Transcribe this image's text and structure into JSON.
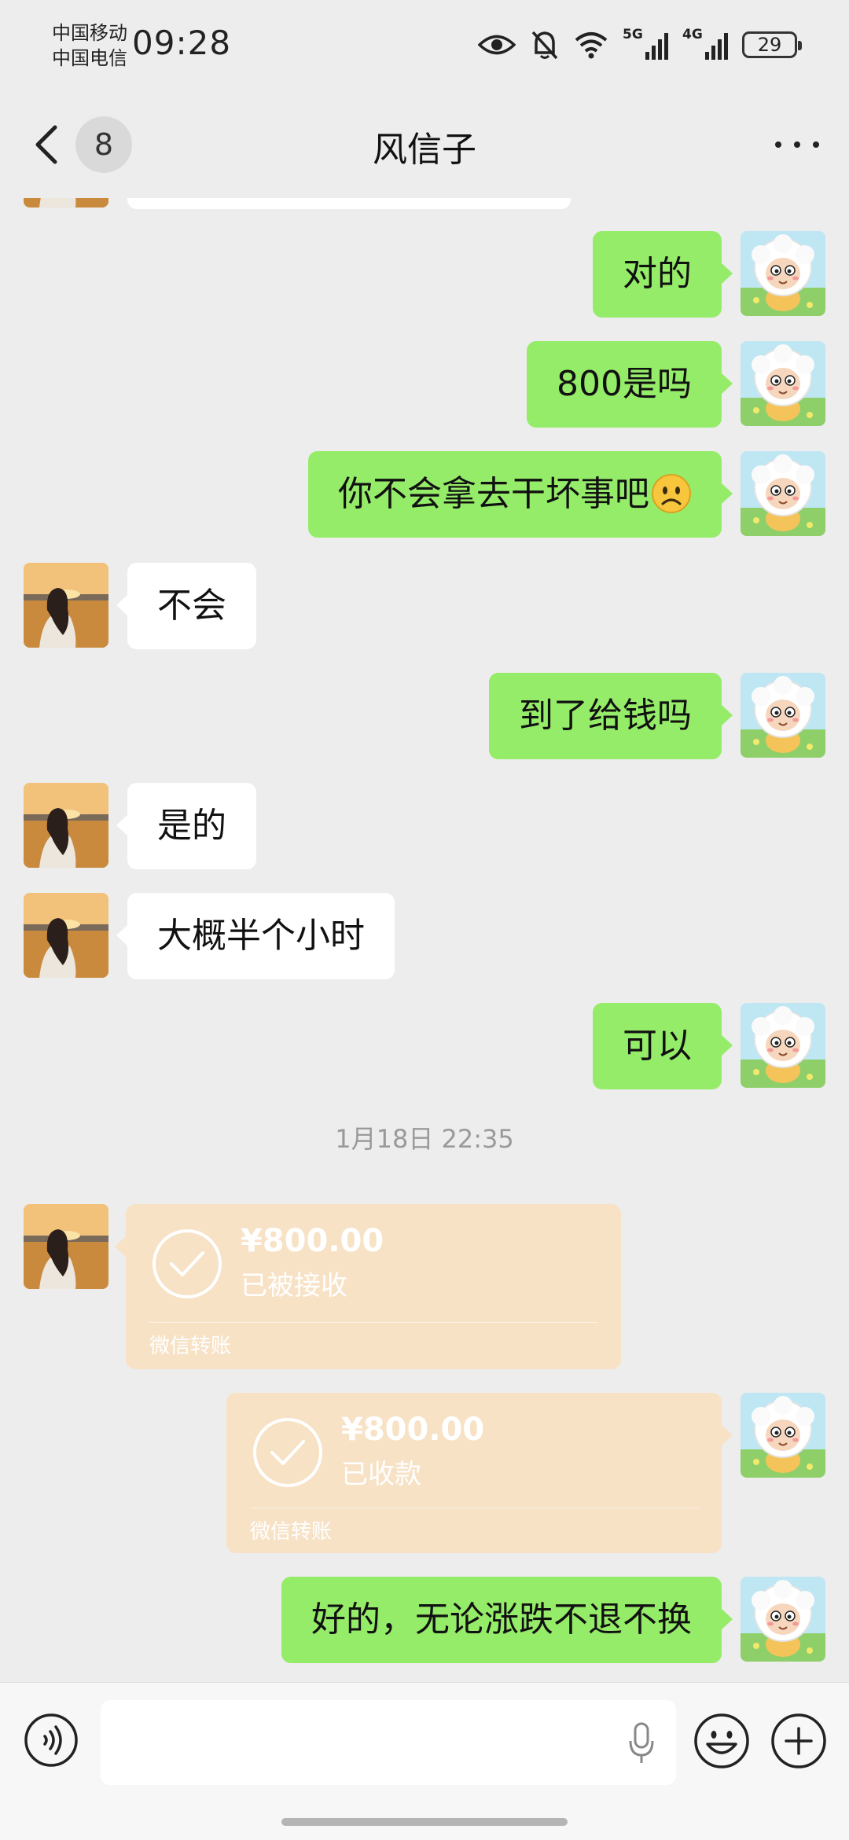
{
  "status_bar": {
    "carrier_1": "中国移动",
    "carrier_2": "中国电信",
    "time": "09:28",
    "net_1": "5G",
    "net_2": "4G",
    "battery": "29",
    "icons": [
      "eye-icon",
      "mute-bell-icon",
      "wifi-icon",
      "signal-icon",
      "battery-icon"
    ]
  },
  "nav": {
    "unread_count": "8",
    "title": "风信子",
    "back_icon": "chevron-left-icon",
    "more_icon": "ellipsis-icon"
  },
  "messages": [
    {
      "side": "out",
      "text": "对的"
    },
    {
      "side": "out",
      "text": "800是吗"
    },
    {
      "side": "out",
      "text": "你不会拿去干坏事吧",
      "emoji": "sad-face"
    },
    {
      "side": "in",
      "text": "不会"
    },
    {
      "side": "out",
      "text": "到了给钱吗"
    },
    {
      "side": "in",
      "text": "是的"
    },
    {
      "side": "in",
      "text": "大概半个小时"
    },
    {
      "side": "out",
      "text": "可以"
    }
  ],
  "timestamp": "1月18日 22:35",
  "transfers": [
    {
      "side": "in",
      "amount": "¥800.00",
      "status": "已被接收",
      "label": "微信转账"
    },
    {
      "side": "out",
      "amount": "¥800.00",
      "status": "已收款",
      "label": "微信转账"
    }
  ],
  "last_message": {
    "side": "out",
    "text": "好的，无论涨跌不退不换"
  },
  "input": {
    "placeholder": "",
    "icons": [
      "voice-icon",
      "microphone-icon",
      "emoji-icon",
      "plus-icon"
    ]
  },
  "colors": {
    "background": "#ededed",
    "outgoing_bubble": "#95ec69",
    "incoming_bubble": "#ffffff",
    "transfer_card": "#f7e2c6"
  }
}
